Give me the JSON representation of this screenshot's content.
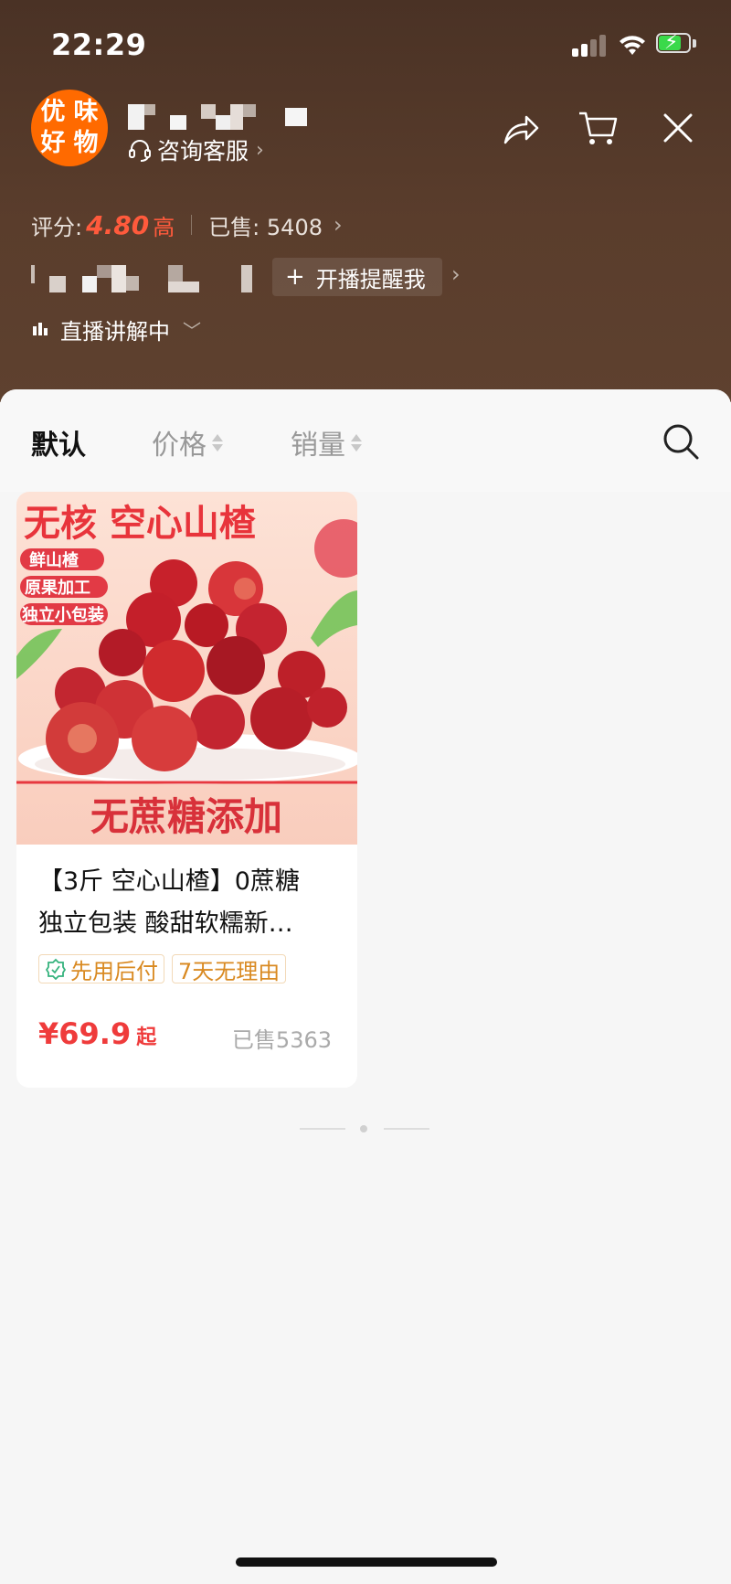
{
  "status_bar": {
    "time": "22:29",
    "battery_icon": "battery-charging-icon",
    "wifi_icon": "wifi-icon",
    "signal_icon": "cellular-signal-icon"
  },
  "shop": {
    "logo_text": [
      "优",
      "味",
      "好",
      "物"
    ],
    "consult_label": "咨询客服",
    "rating_label": "评分:",
    "rating_value": "4.80",
    "rating_level": "高",
    "sold_label": "已售: 5408",
    "remind_label": "开播提醒我",
    "live_label": "直播讲解中"
  },
  "header_icons": [
    "share-icon",
    "cart-icon",
    "close-icon"
  ],
  "sort_bar": {
    "default_label": "默认",
    "price_label": "价格",
    "sales_label": "销量"
  },
  "product": {
    "image_headline": "无核 空心山楂",
    "image_tags": [
      "鲜山楂",
      "原果加工",
      "独立小包装"
    ],
    "image_footer": "无蔗糖添加",
    "title_line1": "【3斤 空心山楂】0蔗糖",
    "title_line2": "独立包装 酸甜软糯新…",
    "tag_pay_later": "先用后付",
    "tag_return": "7天无理由",
    "price": "¥69.9",
    "price_suffix": "起",
    "sold": "已售5363"
  },
  "colors": {
    "header_bg": "#4a3225",
    "accent_red": "#ef3b3b",
    "rating_red": "#ff5a3c",
    "logo_orange": "#ff6a00",
    "tag_orange": "#d98a22"
  }
}
